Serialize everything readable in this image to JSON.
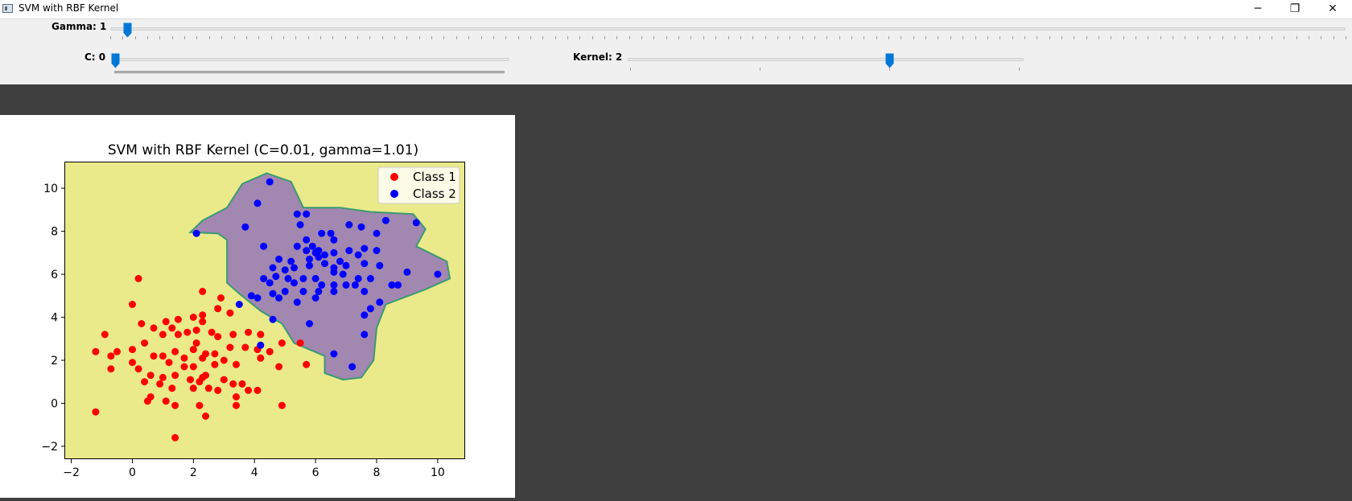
{
  "window": {
    "title": "SVM with RBF Kernel",
    "minimize": "─",
    "restore": "❐",
    "close": "✕"
  },
  "sliders": {
    "gamma": {
      "label": "Gamma: 1",
      "value": 1
    },
    "c": {
      "label": "C: 0",
      "value": 0
    },
    "kernel": {
      "label": "Kernel: 2",
      "value": 2
    }
  },
  "colors": {
    "class1": "#ff0000",
    "class2": "#0000ff",
    "region1": "#eaea8a",
    "region2": "#a287b1",
    "boundary": "#3b9a74",
    "accent": "#0078d7"
  },
  "chart_data": {
    "type": "scatter",
    "title": "SVM with RBF Kernel (C=0.01, gamma=1.01)",
    "xlabel": "",
    "ylabel": "",
    "xlim": [
      -2.2,
      10.9
    ],
    "ylim": [
      -2.6,
      11.2
    ],
    "xticks": [
      -2,
      0,
      2,
      4,
      6,
      8,
      10
    ],
    "yticks": [
      -2,
      0,
      2,
      4,
      6,
      8,
      10
    ],
    "legend": {
      "position": "top-right",
      "entries": [
        "Class 1",
        "Class 2"
      ]
    },
    "decision_boundary": [
      [
        4.4,
        10.7
      ],
      [
        5.2,
        10.3
      ],
      [
        5.6,
        9.1
      ],
      [
        6.8,
        9.1
      ],
      [
        7.8,
        8.9
      ],
      [
        9.2,
        8.8
      ],
      [
        9.6,
        8.1
      ],
      [
        9.3,
        7.3
      ],
      [
        10.3,
        6.6
      ],
      [
        10.4,
        5.8
      ],
      [
        9.6,
        5.3
      ],
      [
        8.3,
        4.6
      ],
      [
        8.0,
        3.5
      ],
      [
        7.9,
        2.0
      ],
      [
        7.5,
        1.2
      ],
      [
        6.9,
        1.1
      ],
      [
        6.3,
        1.4
      ],
      [
        6.3,
        2.2
      ],
      [
        5.3,
        2.8
      ],
      [
        4.9,
        3.7
      ],
      [
        4.2,
        4.3
      ],
      [
        3.5,
        5.1
      ],
      [
        3.1,
        5.6
      ],
      [
        3.1,
        7.6
      ],
      [
        2.8,
        7.9
      ],
      [
        1.9,
        7.95
      ],
      [
        2.3,
        8.5
      ],
      [
        3.1,
        9.1
      ],
      [
        3.6,
        10.2
      ]
    ],
    "series": [
      {
        "name": "Class 1",
        "color": "#ff0000",
        "points": [
          [
            0.2,
            5.8
          ],
          [
            2.3,
            5.2
          ],
          [
            0.0,
            4.6
          ],
          [
            2.9,
            4.9
          ],
          [
            3.2,
            4.2
          ],
          [
            2.8,
            4.4
          ],
          [
            2.3,
            4.1
          ],
          [
            2.0,
            4.0
          ],
          [
            2.3,
            3.8
          ],
          [
            1.5,
            3.9
          ],
          [
            1.1,
            3.8
          ],
          [
            0.3,
            3.7
          ],
          [
            0.7,
            3.5
          ],
          [
            1.3,
            3.5
          ],
          [
            2.1,
            3.4
          ],
          [
            2.6,
            3.3
          ],
          [
            3.3,
            3.2
          ],
          [
            3.8,
            3.3
          ],
          [
            4.2,
            3.2
          ],
          [
            -0.9,
            3.2
          ],
          [
            1.0,
            3.2
          ],
          [
            1.5,
            3.2
          ],
          [
            1.8,
            3.3
          ],
          [
            2.8,
            3.1
          ],
          [
            0.4,
            2.8
          ],
          [
            2.1,
            2.8
          ],
          [
            3.2,
            2.6
          ],
          [
            3.7,
            2.6
          ],
          [
            4.1,
            2.5
          ],
          [
            4.5,
            2.4
          ],
          [
            4.9,
            2.8
          ],
          [
            5.5,
            2.8
          ],
          [
            -1.2,
            2.4
          ],
          [
            -0.5,
            2.4
          ],
          [
            0.0,
            2.5
          ],
          [
            1.4,
            2.4
          ],
          [
            2.0,
            2.5
          ],
          [
            2.4,
            2.3
          ],
          [
            2.7,
            2.3
          ],
          [
            0.7,
            2.2
          ],
          [
            1.0,
            2.2
          ],
          [
            1.7,
            2.1
          ],
          [
            2.3,
            2.1
          ],
          [
            3.0,
            2.0
          ],
          [
            4.2,
            2.1
          ],
          [
            -0.7,
            2.2
          ],
          [
            0.0,
            1.9
          ],
          [
            1.2,
            1.9
          ],
          [
            1.7,
            1.7
          ],
          [
            2.0,
            1.7
          ],
          [
            2.7,
            1.8
          ],
          [
            3.4,
            1.8
          ],
          [
            4.8,
            1.7
          ],
          [
            5.7,
            1.8
          ],
          [
            -0.7,
            1.6
          ],
          [
            0.2,
            1.6
          ],
          [
            0.6,
            1.3
          ],
          [
            1.0,
            1.2
          ],
          [
            1.4,
            1.3
          ],
          [
            2.4,
            1.3
          ],
          [
            1.9,
            1.1
          ],
          [
            2.3,
            1.2
          ],
          [
            3.0,
            1.1
          ],
          [
            0.4,
            1.0
          ],
          [
            0.9,
            0.9
          ],
          [
            2.2,
            1.0
          ],
          [
            3.3,
            0.9
          ],
          [
            3.6,
            0.9
          ],
          [
            1.3,
            0.7
          ],
          [
            2.0,
            0.7
          ],
          [
            2.5,
            0.7
          ],
          [
            2.8,
            0.6
          ],
          [
            3.8,
            0.6
          ],
          [
            4.1,
            0.6
          ],
          [
            0.6,
            0.3
          ],
          [
            3.4,
            0.3
          ],
          [
            0.5,
            0.1
          ],
          [
            1.1,
            0.1
          ],
          [
            1.4,
            -0.1
          ],
          [
            2.2,
            -0.1
          ],
          [
            3.4,
            -0.1
          ],
          [
            4.9,
            -0.1
          ],
          [
            -1.2,
            -0.4
          ],
          [
            2.4,
            -0.6
          ],
          [
            1.4,
            -1.6
          ]
        ]
      },
      {
        "name": "Class 2",
        "color": "#0000ff",
        "points": [
          [
            4.5,
            10.3
          ],
          [
            4.1,
            9.3
          ],
          [
            5.4,
            8.8
          ],
          [
            5.7,
            8.8
          ],
          [
            5.5,
            8.3
          ],
          [
            9.3,
            8.4
          ],
          [
            8.3,
            8.5
          ],
          [
            2.1,
            7.9
          ],
          [
            3.7,
            8.2
          ],
          [
            6.2,
            7.9
          ],
          [
            6.5,
            7.9
          ],
          [
            7.1,
            8.3
          ],
          [
            7.5,
            8.2
          ],
          [
            8.0,
            7.9
          ],
          [
            5.7,
            7.6
          ],
          [
            6.6,
            7.6
          ],
          [
            7.1,
            7.1
          ],
          [
            7.6,
            7.2
          ],
          [
            8.0,
            7.1
          ],
          [
            4.3,
            7.3
          ],
          [
            5.4,
            7.3
          ],
          [
            5.9,
            7.3
          ],
          [
            6.0,
            7.0
          ],
          [
            6.1,
            7.1
          ],
          [
            6.3,
            6.9
          ],
          [
            6.6,
            7.0
          ],
          [
            5.7,
            7.1
          ],
          [
            5.2,
            6.6
          ],
          [
            5.8,
            6.7
          ],
          [
            6.1,
            6.8
          ],
          [
            6.3,
            6.5
          ],
          [
            6.8,
            6.6
          ],
          [
            7.4,
            6.9
          ],
          [
            7.0,
            6.4
          ],
          [
            4.8,
            6.7
          ],
          [
            4.6,
            6.3
          ],
          [
            5.0,
            6.2
          ],
          [
            5.3,
            6.3
          ],
          [
            5.8,
            6.4
          ],
          [
            6.6,
            6.3
          ],
          [
            7.6,
            6.5
          ],
          [
            8.1,
            6.4
          ],
          [
            9.0,
            6.1
          ],
          [
            10.0,
            6.0
          ],
          [
            4.3,
            5.8
          ],
          [
            4.7,
            5.9
          ],
          [
            5.1,
            5.8
          ],
          [
            5.6,
            5.8
          ],
          [
            6.0,
            5.8
          ],
          [
            6.6,
            6.1
          ],
          [
            6.9,
            6.0
          ],
          [
            7.4,
            5.8
          ],
          [
            7.8,
            5.8
          ],
          [
            4.5,
            5.6
          ],
          [
            5.3,
            5.6
          ],
          [
            6.2,
            5.5
          ],
          [
            6.6,
            5.5
          ],
          [
            7.0,
            5.5
          ],
          [
            7.3,
            5.5
          ],
          [
            8.5,
            5.5
          ],
          [
            8.7,
            5.5
          ],
          [
            7.6,
            5.2
          ],
          [
            4.6,
            5.1
          ],
          [
            5.0,
            5.2
          ],
          [
            5.6,
            5.2
          ],
          [
            6.1,
            5.2
          ],
          [
            6.6,
            5.2
          ],
          [
            3.9,
            5.0
          ],
          [
            4.1,
            4.9
          ],
          [
            4.8,
            4.9
          ],
          [
            5.4,
            4.7
          ],
          [
            6.0,
            4.9
          ],
          [
            8.1,
            4.7
          ],
          [
            3.5,
            4.6
          ],
          [
            7.8,
            4.4
          ],
          [
            7.6,
            4.1
          ],
          [
            4.6,
            3.9
          ],
          [
            5.8,
            3.7
          ],
          [
            7.6,
            3.2
          ],
          [
            4.2,
            2.7
          ],
          [
            6.6,
            2.3
          ],
          [
            7.2,
            1.7
          ]
        ]
      }
    ]
  }
}
